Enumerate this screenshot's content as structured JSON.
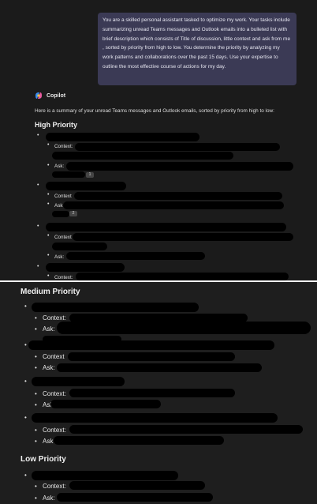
{
  "conversation": {
    "user_prompt": "You are a skilled personal assistant tasked to optimize my work. Your tasks include summarizing unread Teams messages and Outlook emails into a bulleted list with brief description which consists of Title of discussion, little context and ask from me , sorted by priority from high to low. You determine the priority by analyzing my work patterns and collaborations over the past 15 days. Use your expertise to outline the most effective course of actions for my day.",
    "assistant_name": "Copilot",
    "assistant_intro": "Here is a summary of your unread Teams messages and Outlook emails, sorted by priority from high to low:"
  },
  "summary": {
    "high_priority_title": "High Priority",
    "medium_priority_title": "Medium Priority",
    "low_priority_title": "Low Priority",
    "bullet": "•",
    "context_label": "Context:",
    "ask_label": "Ask:",
    "context_label_cut": "Context",
    "ask_label_cut": "Ask",
    "citations": [
      "1",
      "2"
    ]
  },
  "colors": {
    "user_bubble": "#3b3a55",
    "background": "#1b1b1b",
    "redaction": "#000000"
  }
}
